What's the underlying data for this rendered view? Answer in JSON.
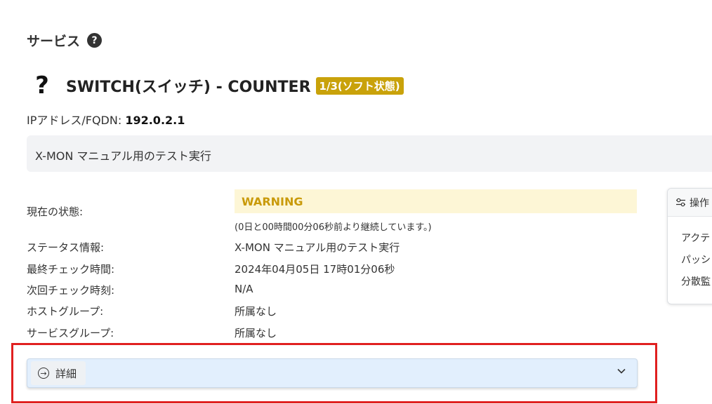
{
  "section": {
    "title": "サービス",
    "help_icon": "?"
  },
  "service": {
    "status_icon": "?",
    "name": "SWITCH(スイッチ) - COUNTER",
    "state_badge": "1/3(ソフト状態)"
  },
  "ip": {
    "label": "IPアドレス/FQDN: ",
    "value": "192.0.2.1"
  },
  "description": "X-MON マニュアル用のテスト実行",
  "details_table": {
    "current_state_label": "現在の状態:",
    "current_state_value": "WARNING",
    "duration": "(0日と00時間00分06秒前より継続しています。)",
    "rows": [
      {
        "label": "ステータス情報:",
        "value": "X-MON マニュアル用のテスト実行"
      },
      {
        "label": "最終チェック時間:",
        "value": "2024年04月05日 17時01分06秒"
      },
      {
        "label": "次回チェック時刻:",
        "value": "N/A"
      },
      {
        "label": "ホストグループ:",
        "value": "所属なし"
      },
      {
        "label": "サービスグループ:",
        "value": "所属なし"
      }
    ]
  },
  "operations": {
    "title": "操作",
    "items": [
      "アクテ",
      "パッシ",
      "分散監"
    ]
  },
  "details_toggle": {
    "label": "詳細"
  },
  "colors": {
    "badge": "#c9a20a",
    "warning_bg": "#fdf6d6",
    "warning_text": "#c99a0a",
    "highlight_frame": "#e02020",
    "details_bar": "#e2effd"
  }
}
